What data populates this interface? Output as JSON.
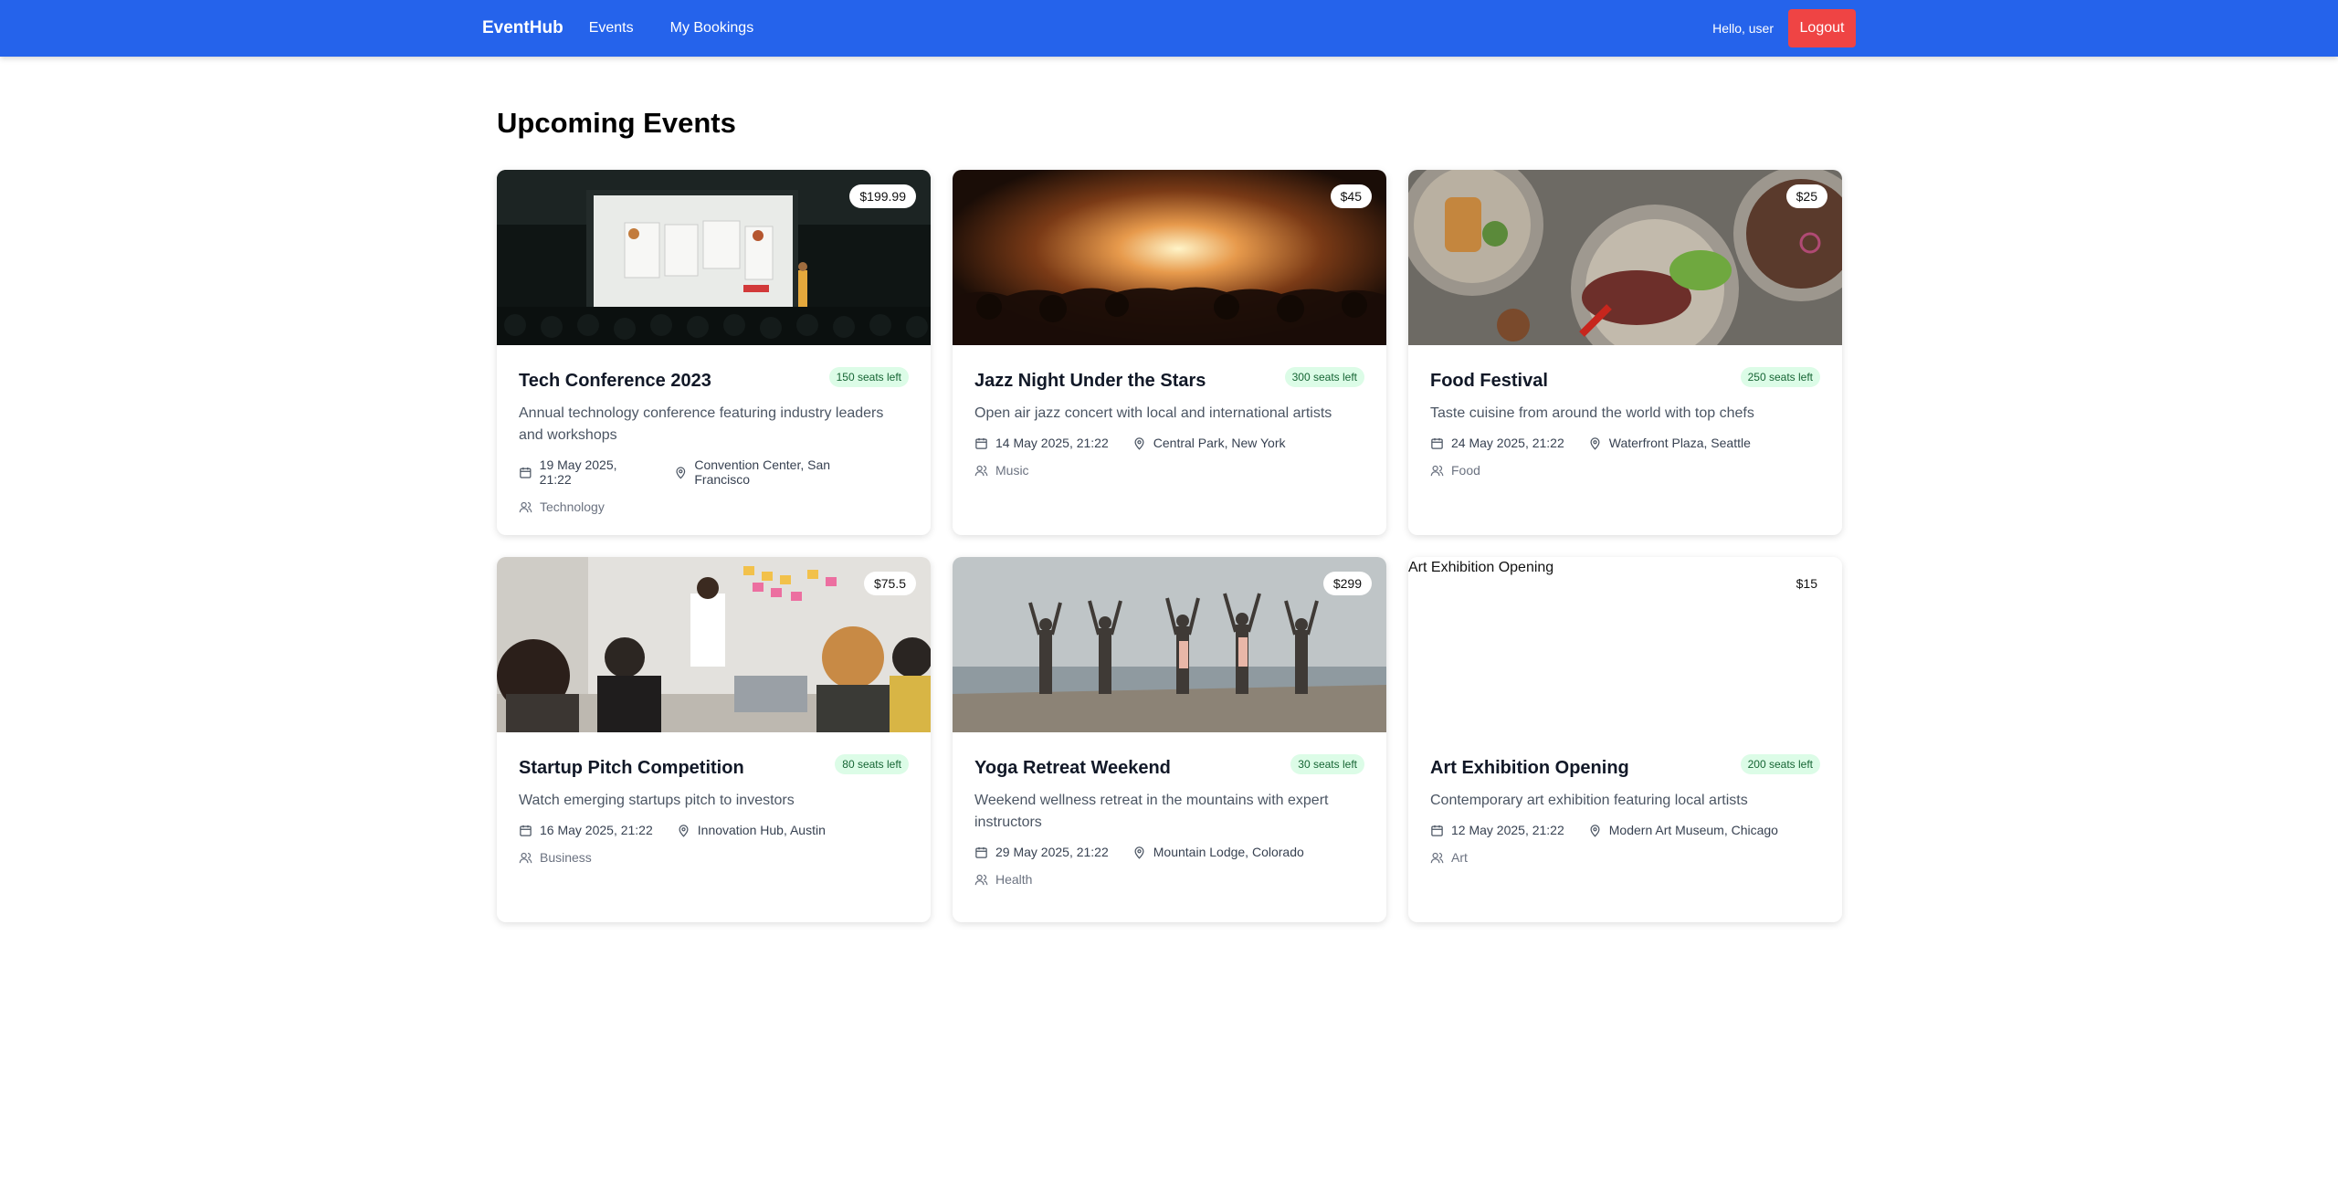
{
  "navbar": {
    "brand": "EventHub",
    "links": [
      "Events",
      "My Bookings"
    ],
    "greeting": "Hello, user",
    "logout_label": "Logout"
  },
  "page_title": "Upcoming Events",
  "events": [
    {
      "title": "Tech Conference 2023",
      "price": "$199.99",
      "seats": "150 seats left",
      "description": "Annual technology conference featuring industry leaders and workshops",
      "date": "19 May 2025, 21:22",
      "location": "Convention Center, San Francisco",
      "category": "Technology",
      "image_alt": "",
      "image_scene": "conference"
    },
    {
      "title": "Jazz Night Under the Stars",
      "price": "$45",
      "seats": "300 seats left",
      "description": "Open air jazz concert with local and international artists",
      "date": "14 May 2025, 21:22",
      "location": "Central Park, New York",
      "category": "Music",
      "image_alt": "",
      "image_scene": "concert"
    },
    {
      "title": "Food Festival",
      "price": "$25",
      "seats": "250 seats left",
      "description": "Taste cuisine from around the world with top chefs",
      "date": "24 May 2025, 21:22",
      "location": "Waterfront Plaza, Seattle",
      "category": "Food",
      "image_alt": "",
      "image_scene": "food"
    },
    {
      "title": "Startup Pitch Competition",
      "price": "$75.5",
      "seats": "80 seats left",
      "description": "Watch emerging startups pitch to investors",
      "date": "16 May 2025, 21:22",
      "location": "Innovation Hub, Austin",
      "category": "Business",
      "image_alt": "",
      "image_scene": "office"
    },
    {
      "title": "Yoga Retreat Weekend",
      "price": "$299",
      "seats": "30 seats left",
      "description": "Weekend wellness retreat in the mountains with expert instructors",
      "date": "29 May 2025, 21:22",
      "location": "Mountain Lodge, Colorado",
      "category": "Health",
      "image_alt": "",
      "image_scene": "beach-yoga"
    },
    {
      "title": "Art Exhibition Opening",
      "price": "$15",
      "seats": "200 seats left",
      "description": "Contemporary art exhibition featuring local artists",
      "date": "12 May 2025, 21:22",
      "location": "Modern Art Museum, Chicago",
      "category": "Art",
      "image_alt": "Art Exhibition Opening",
      "image_scene": "broken"
    }
  ],
  "icons": {
    "calendar": "calendar-icon",
    "location": "map-pin-icon",
    "category": "users-icon"
  },
  "colors": {
    "navbar": "#2563eb",
    "logout": "#ef4444",
    "seats_bg": "#dcfce7",
    "seats_text": "#166534"
  }
}
